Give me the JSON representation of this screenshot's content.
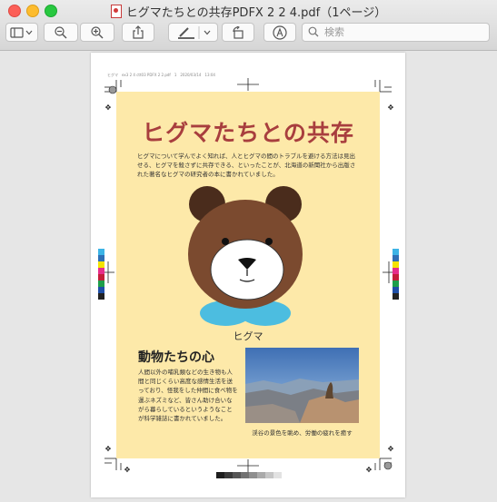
{
  "window": {
    "title": "ヒグマたちとの共存PDFX 2 2 4.pdf（1ページ）",
    "file_icon": "pdf-file-icon"
  },
  "toolbar": {
    "buttons": [
      {
        "name": "sidebar-toggle",
        "icon": "sidebar-icon"
      },
      {
        "name": "zoom-out",
        "icon": "zoom-out-icon"
      },
      {
        "name": "zoom-in",
        "icon": "zoom-in-icon"
      },
      {
        "name": "share",
        "icon": "share-icon"
      },
      {
        "name": "markup-pen",
        "icon": "pen-icon"
      },
      {
        "name": "rotate",
        "icon": "rotate-icon"
      },
      {
        "name": "markup-toolbar",
        "icon": "markup-circle-icon"
      }
    ],
    "search_placeholder": "検索"
  },
  "page": {
    "slug_line": "ヒグマ　ex3 2 4 ctt03 PDFX 2 2.pdf　1　2020/03/14　13:04",
    "heading": "ヒグマたちとの共存",
    "intro": "ヒグマについて学んでよく知れば、人とヒグマの間のトラブルを避ける方法は見出せる、ヒグマを殺さずに共存できる、といったことが、北海道の新聞社から出版された著名なヒグマの研究者の本に書かれていました。",
    "bear_caption": "ヒグマ",
    "section_title": "動物たちの心",
    "section_body": "人間以外の哺乳類などの生き物も人間と同じくらい高度な感情生活を送っており、怪我をした仲間に食べ物を運ぶネズミなど、皆さん助け合いながら暮らしているというようなことが科学雑誌に書かれていました。",
    "photo_caption": "渓谷の景色を眺め、労働の疲れを癒す"
  },
  "colors": {
    "poster_bg": "#fde9a9",
    "heading": "#a83e3e",
    "bear_brown": "#7b4a2f",
    "bear_ears": "#4a2c1c",
    "collar": "#4cbde0",
    "color_bar": [
      "#3cb4e6",
      "#2e6fb5",
      "#f4e300",
      "#e62e8b",
      "#c41e3a",
      "#1e9e4a",
      "#1f4fa6",
      "#222222"
    ]
  }
}
